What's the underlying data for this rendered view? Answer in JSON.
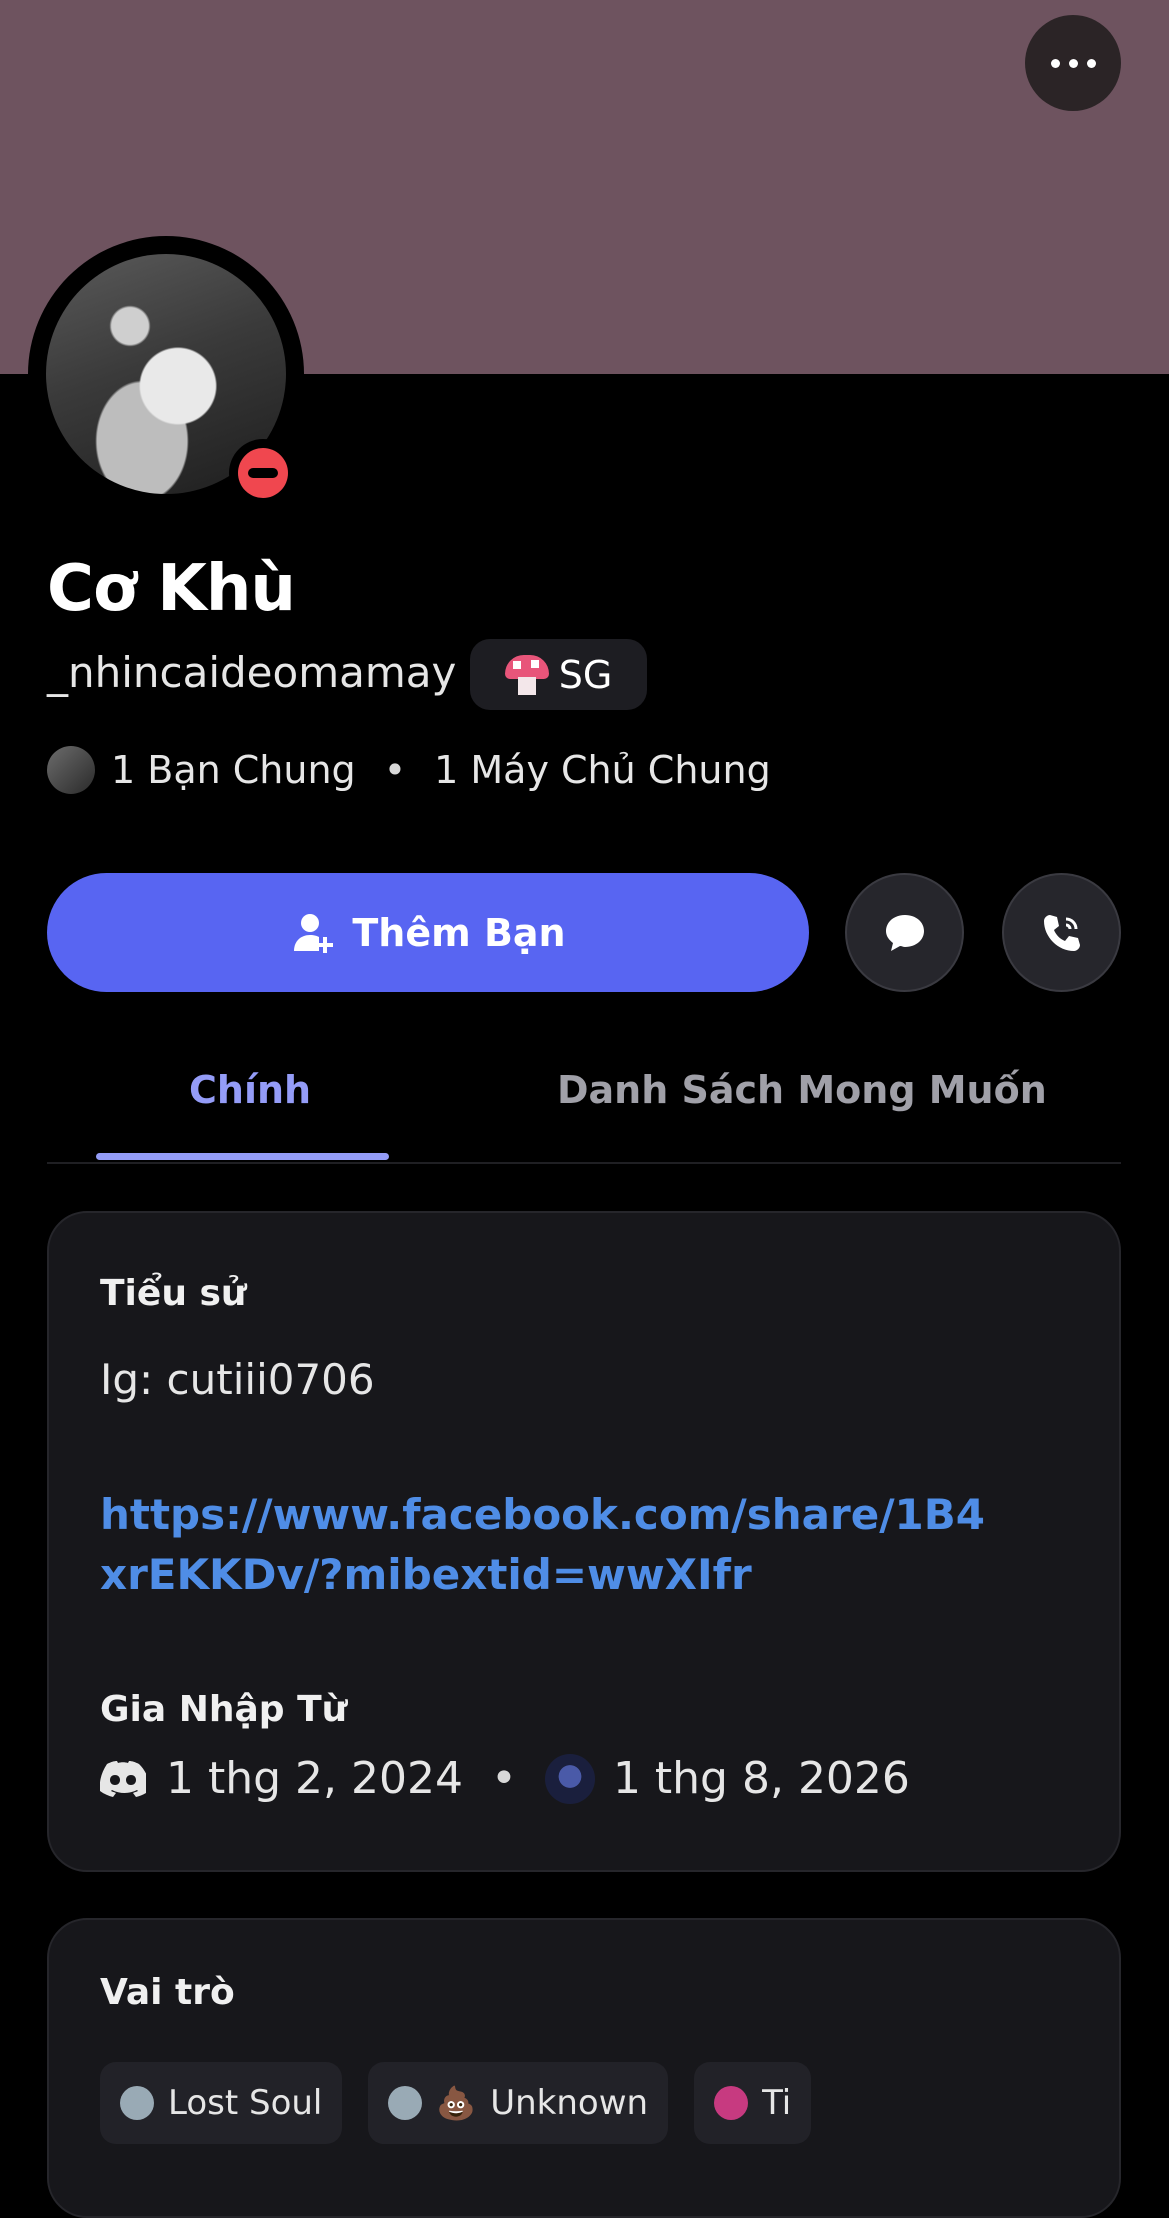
{
  "profile": {
    "display_name": "Cơ Khù",
    "username": "_nhincaideomamay",
    "tag": "SG",
    "mutual_friends": "1 Bạn Chung",
    "mutual_servers": "1 Máy Chủ Chung",
    "separator": "•"
  },
  "actions": {
    "add_friend_label": "Thêm Bạn"
  },
  "tabs": [
    {
      "label": "Chính",
      "active": true
    },
    {
      "label": "Danh Sách Mong Muốn",
      "active": false
    }
  ],
  "bio": {
    "title": "Tiểu sử",
    "ig_line": "Ig: cutiii0706",
    "link": "https://www.facebook.com/share/1B4xrEKKDv/?mibextid=wwXIfr"
  },
  "member_since": {
    "title": "Gia Nhập Từ",
    "discord_date": "1 thg 2, 2024",
    "server_date": "1 thg 8, 2026"
  },
  "roles": {
    "title": "Vai trò",
    "items": [
      {
        "name": "Lost Soul",
        "color": "#99aab5"
      },
      {
        "name": "Unknown",
        "color": "#99aab5",
        "emoji": "💩"
      },
      {
        "name": "Ti",
        "color": "#c73a80"
      }
    ]
  },
  "colors": {
    "banner": "#6e535f",
    "accent": "#5865f2",
    "tab_active": "#949cf7",
    "link": "#4f8de6",
    "status_dnd": "#f0474f"
  },
  "icons": [
    "more-icon",
    "add-friend-icon",
    "message-icon",
    "call-icon",
    "discord-icon",
    "mushroom-icon"
  ]
}
